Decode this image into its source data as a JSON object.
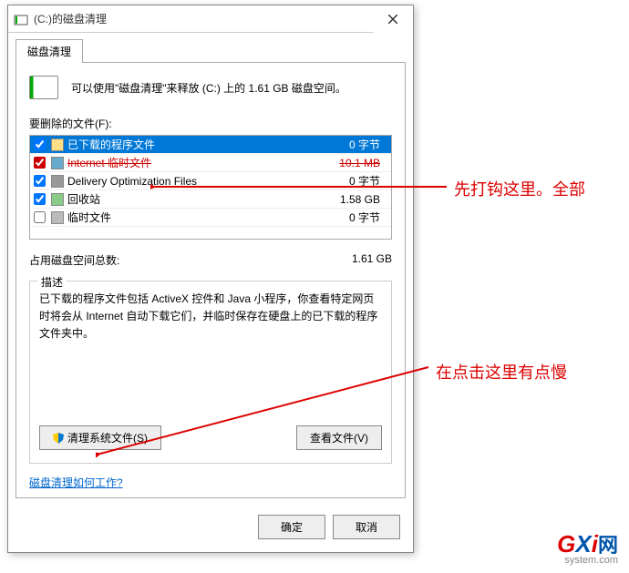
{
  "titlebar": {
    "title": "(C:)的磁盘清理"
  },
  "tab": {
    "label": "磁盘清理"
  },
  "info": {
    "text": "可以使用\"磁盘清理\"来释放 (C:) 上的 1.61 GB 磁盘空间。"
  },
  "files": {
    "label": "要删除的文件(F):",
    "items": [
      {
        "name": "已下载的程序文件",
        "size": "0 字节",
        "checked": true,
        "selected": true,
        "icon": "folder"
      },
      {
        "name": "Internet 临时文件",
        "size": "10.1 MB",
        "checked": true,
        "redstrike": true,
        "icon": "ie"
      },
      {
        "name": "Delivery Optimization Files",
        "size": "0 字节",
        "checked": true,
        "icon": "opt"
      },
      {
        "name": "回收站",
        "size": "1.58 GB",
        "checked": true,
        "icon": "recycle"
      },
      {
        "name": "临时文件",
        "size": "0 字节",
        "checked": false,
        "icon": "temp"
      }
    ]
  },
  "total": {
    "label": "占用磁盘空间总数:",
    "value": "1.61 GB"
  },
  "desc": {
    "title": "描述",
    "text": "已下载的程序文件包括 ActiveX 控件和 Java 小程序，你查看特定网页时将会从 Internet 自动下载它们，并临时保存在硬盘上的已下载的程序文件夹中。",
    "clean_btn": "清理系统文件(S)",
    "view_btn": "查看文件(V)"
  },
  "link": {
    "text": "磁盘清理如何工作?"
  },
  "footer": {
    "ok": "确定",
    "cancel": "取消"
  },
  "annotations": {
    "a1": "先打钩这里。全部",
    "a2": "在点击这里有点慢"
  },
  "logo": {
    "g": "G",
    "x": "X",
    "i": "i",
    "cn": "网",
    "sub": "system.com"
  }
}
